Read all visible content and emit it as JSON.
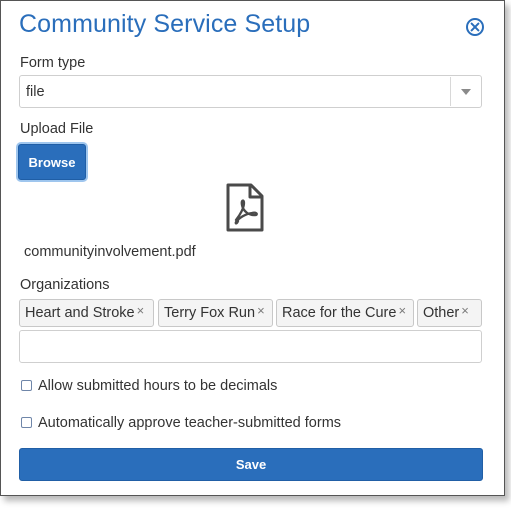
{
  "dialog": {
    "title": "Community Service Setup",
    "close_icon": "close-circle-icon"
  },
  "form_type": {
    "label": "Form type",
    "value": "file",
    "arrow_icon": "triangle-down-icon"
  },
  "upload": {
    "label": "Upload File",
    "browse_label": "Browse",
    "file_icon": "pdf-file-icon",
    "file_name": "communityinvolvement.pdf"
  },
  "organizations": {
    "label": "Organizations",
    "tags": [
      {
        "label": "Heart and Stroke"
      },
      {
        "label": "Terry Fox Run"
      },
      {
        "label": "Race for the Cure"
      },
      {
        "label": "Other"
      }
    ],
    "remove_glyph": "×",
    "input_value": ""
  },
  "options": {
    "decimals": {
      "label": "Allow submitted hours to be decimals",
      "checked": false
    },
    "auto_approve": {
      "label": "Automatically approve teacher-submitted forms",
      "checked": false
    }
  },
  "save_label": "Save",
  "colors": {
    "accent": "#2a6ebb",
    "text": "#333333",
    "border": "#cfcfcf"
  }
}
